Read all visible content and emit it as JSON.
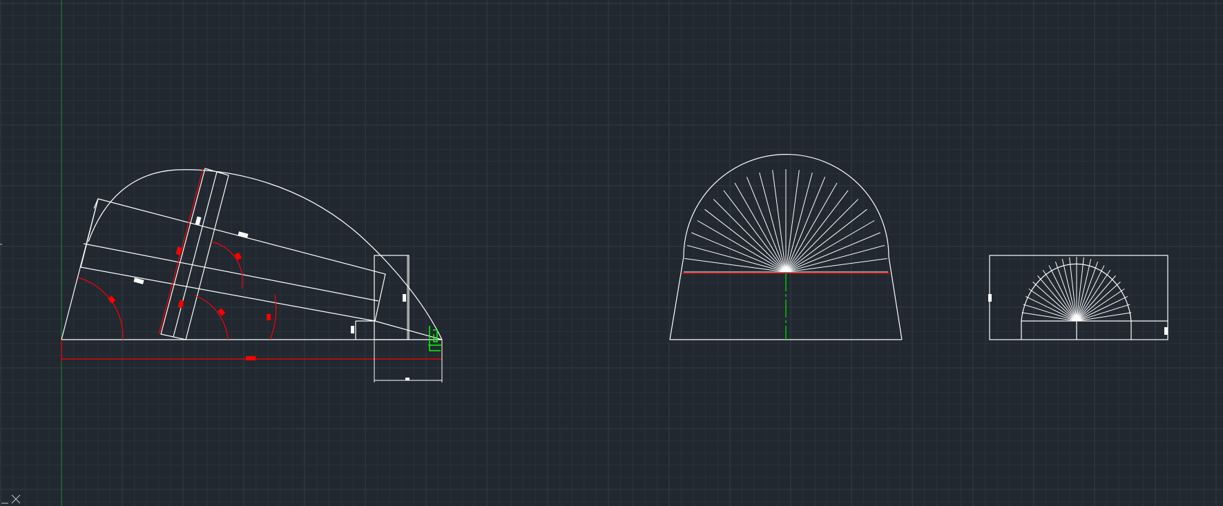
{
  "app": {
    "view": "model-space-drawing"
  },
  "colors": {
    "background": "#212830",
    "grid_minor": "#2a323c",
    "grid_major": "#333c47",
    "geometry": "#ffffff",
    "dimension_red": "#ff0000",
    "axis_y_green": "#1e8a1e",
    "centerline_green": "#00c800",
    "selection_green": "#00ff00",
    "dimension_text": "#ffffff"
  },
  "icons": {
    "ucs": "ucs-axis-icon",
    "cursor": "crosshair-cursor-icon"
  }
}
